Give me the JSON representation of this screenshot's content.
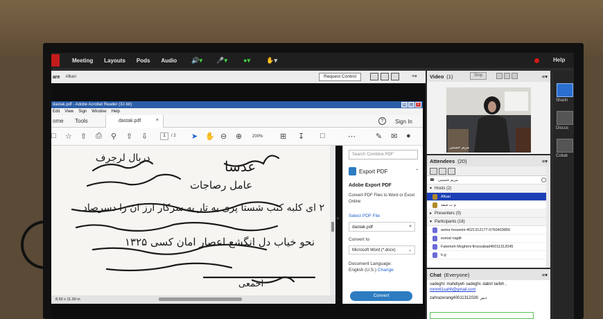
{
  "topbar": {
    "menus": [
      "Meeting",
      "Layouts",
      "Pods",
      "Audio"
    ],
    "help": "Help"
  },
  "share": {
    "title": "are",
    "presenter": "Afkari",
    "request_control": "Request Control"
  },
  "acrobat": {
    "window_title": "dastak.pdf - Adobe Acrobat Reader (32-bit)",
    "menu": [
      "Edit",
      "View",
      "Sign",
      "Window",
      "Help"
    ],
    "tab_home": "ome",
    "tab_tools": "Tools",
    "doc_tab": "dastak.pdf",
    "sign_in": "Sign In",
    "page_current": "1",
    "page_total": "/ 2",
    "zoom": "200%",
    "page_size": "8.50 x 11.00 in"
  },
  "export_panel": {
    "search_placeholder": "Search 'Combine PDF'",
    "export_label": "Export PDF",
    "heading": "Adobe Export PDF",
    "description": "Convert PDF Files to Word or Excel Online",
    "select_link": "Select PDF File",
    "file_name": "dastak.pdf",
    "convert_to_label": "Convert to",
    "convert_to_value": "Microsoft Word (*.docx)",
    "doc_language_label": "Document Language:",
    "doc_language_value": "English (U.S.)",
    "change_link": "Change",
    "convert_button": "Convert"
  },
  "video": {
    "title": "Video",
    "count": "(1)",
    "stop_label": "Stop",
    "caption": "مریم حسینی"
  },
  "attendees": {
    "title": "Attendees",
    "count": "(20)",
    "status_user": "مریم حسینی",
    "hosts_label": "Hosts (2)",
    "hosts": [
      "Afkari",
      "م ب صفه"
    ],
    "presenters_label": "Presenters (0)",
    "participants_label": "Participants (18)",
    "participants": [
      "asma hosseini-4021312177-0760403856",
      "esmat najafi",
      "Fatemeh Moghimi firoozabad40011312045",
      "h.g"
    ]
  },
  "chat": {
    "title": "Chat",
    "scope": "(Everyone)",
    "messages": [
      {
        "text": "sadeghi: mahdiyeh sadeghi. dabiri tarikh ,"
      },
      {
        "link": "mmn61sahh@gmail.com"
      },
      {
        "text": "zahrazerang40011312026: دبیر"
      }
    ]
  },
  "rail": {
    "items": [
      "Sharin",
      "Discus",
      "Collab"
    ]
  },
  "handwriting": [
    "عدسا",
    "دربال لرجرف",
    "عامل رصاجات",
    "۲ ای کلبه کتب شستا پری به تار به سرکار ارز ان را دسرصاد",
    "نحو خیاب دل انگشع اعصار امان کسی ۱۳۲۵",
    "احمعی"
  ],
  "colors": {
    "acrobat_title": "#2b5ea8",
    "selected_host": "#1b3fb5",
    "mic_green": "#3fcf3f",
    "record_red": "#d01b1b"
  }
}
